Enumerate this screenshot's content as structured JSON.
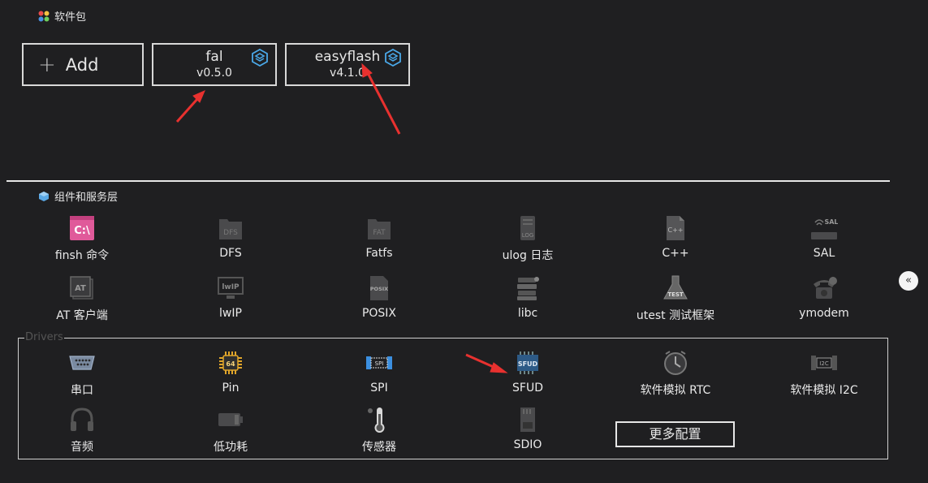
{
  "packages": {
    "title": "软件包",
    "add_label": "Add",
    "add_icon": "plus-icon",
    "items": [
      {
        "name": "fal",
        "version": "v0.5.0",
        "icon": "package-cube-icon"
      },
      {
        "name": "easyflash",
        "version": "v4.1.0",
        "icon": "package-cube-icon"
      }
    ]
  },
  "components": {
    "title": "组件和服务层",
    "items": [
      {
        "label": "finsh 命令",
        "icon": "terminal-icon"
      },
      {
        "label": "DFS",
        "icon": "dfs-folder-icon"
      },
      {
        "label": "Fatfs",
        "icon": "fat-folder-icon"
      },
      {
        "label": "ulog 日志",
        "icon": "log-file-icon"
      },
      {
        "label": "C++",
        "icon": "cpp-file-icon"
      },
      {
        "label": "SAL",
        "icon": "router-icon"
      },
      {
        "label": "AT 客户端",
        "icon": "at-client-icon"
      },
      {
        "label": "lwIP",
        "icon": "lwip-monitor-icon"
      },
      {
        "label": "POSIX",
        "icon": "posix-file-icon"
      },
      {
        "label": "libc",
        "icon": "books-icon"
      },
      {
        "label": "utest 测试框架",
        "icon": "test-flask-icon"
      },
      {
        "label": "ymodem",
        "icon": "telephone-icon"
      }
    ]
  },
  "drivers": {
    "title": "Drivers",
    "items": [
      {
        "label": "串口",
        "icon": "serial-port-icon"
      },
      {
        "label": "Pin",
        "icon": "chip-icon"
      },
      {
        "label": "SPI",
        "icon": "spi-icon"
      },
      {
        "label": "SFUD",
        "icon": "sfud-chip-icon"
      },
      {
        "label": "软件模拟 RTC",
        "icon": "clock-icon"
      },
      {
        "label": "软件模拟 I2C",
        "icon": "i2c-icon"
      },
      {
        "label": "音频",
        "icon": "headphones-icon"
      },
      {
        "label": "低功耗",
        "icon": "battery-icon"
      },
      {
        "label": "传感器",
        "icon": "thermometer-icon"
      },
      {
        "label": "SDIO",
        "icon": "sd-card-icon"
      }
    ],
    "more_label": "更多配置"
  },
  "collapse_label": "«",
  "colors": {
    "background": "#1f1f21",
    "annotation_arrow": "#e8312f",
    "accent_blue": "#4aa8e8"
  }
}
